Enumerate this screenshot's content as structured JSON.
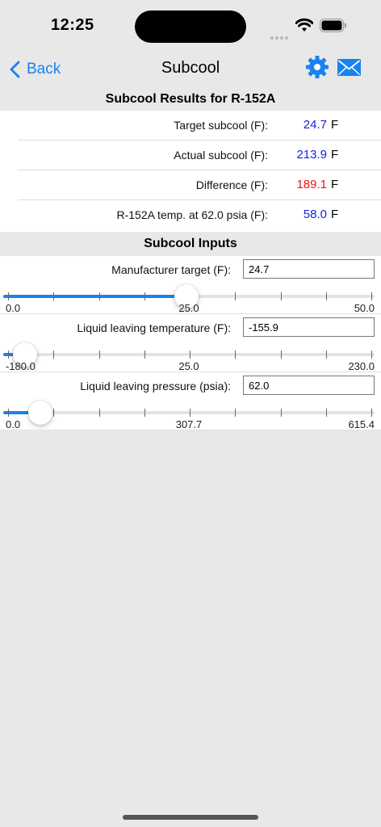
{
  "status": {
    "time": "12:25"
  },
  "nav": {
    "back_label": "Back",
    "title": "Subcool"
  },
  "results": {
    "header": "Subcool Results for R-152A",
    "rows": [
      {
        "label": "Target subcool (F):",
        "value": "24.7",
        "unit": "F",
        "color": "#1a22d8"
      },
      {
        "label": "Actual subcool (F):",
        "value": "213.9",
        "unit": "F",
        "color": "#1a22d8"
      },
      {
        "label": "Difference (F):",
        "value": "189.1",
        "unit": "F",
        "color": "#e0121a"
      },
      {
        "label": "R-152A temp. at 62.0 psia (F):",
        "value": "58.0",
        "unit": "F",
        "color": "#1a22d8"
      }
    ]
  },
  "inputs": {
    "header": "Subcool Inputs",
    "rows": [
      {
        "label": "Manufacturer target (F):",
        "value": "24.7",
        "slider": {
          "min": "0.0",
          "mid": "25.0",
          "max": "50.0",
          "fraction": 0.494
        }
      },
      {
        "label": "Liquid leaving temperature (F):",
        "value": "-155.9",
        "slider": {
          "min": "-180.0",
          "mid": "25.0",
          "max": "230.0",
          "fraction": 0.059
        }
      },
      {
        "label": "Liquid leaving pressure (psia):",
        "value": "62.0",
        "slider": {
          "min": "0.0",
          "mid": "307.7",
          "max": "615.4",
          "fraction": 0.101
        }
      }
    ]
  },
  "colors": {
    "accent": "#1a82f0",
    "value_blue": "#1a22d8",
    "value_red": "#e0121a"
  },
  "icons": [
    "chevron-left-icon",
    "gear-icon",
    "mail-icon",
    "wifi-icon",
    "battery-icon"
  ]
}
